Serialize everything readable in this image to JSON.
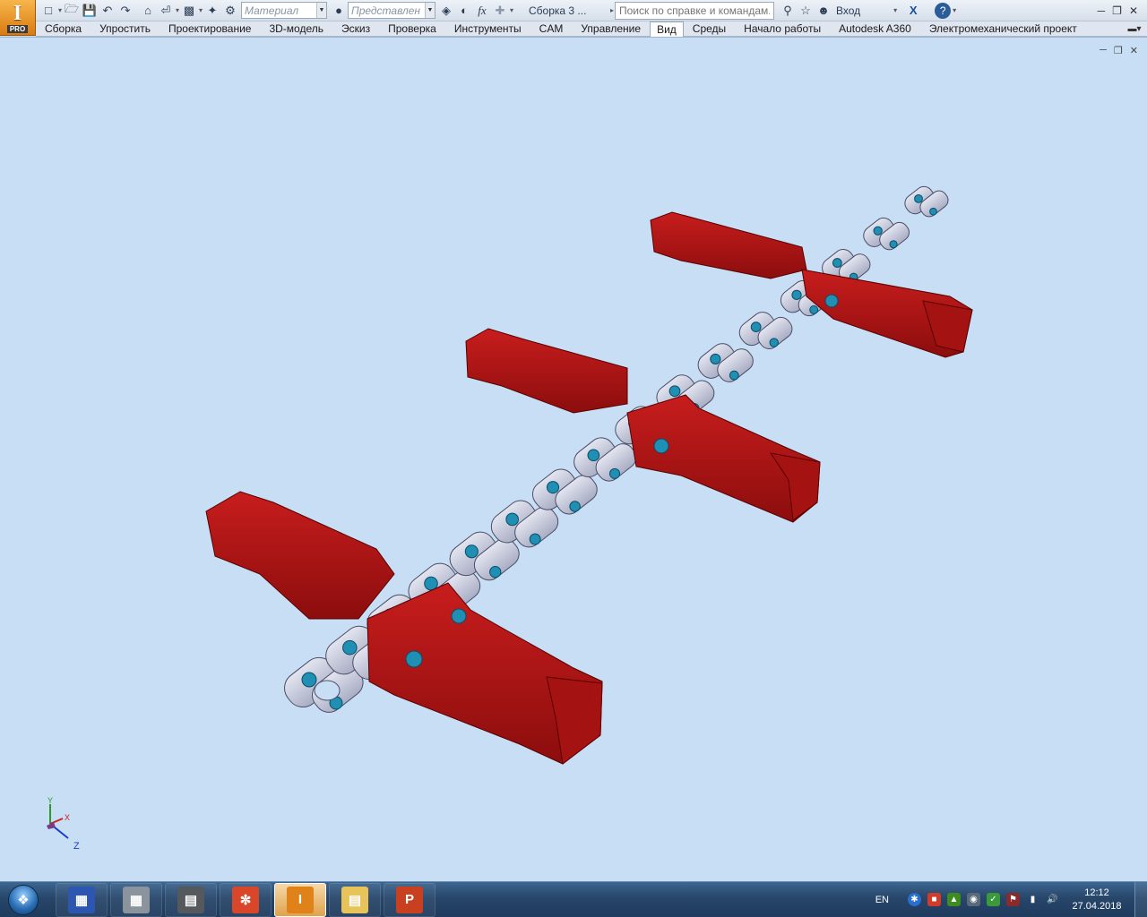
{
  "app": {
    "logo": "I",
    "edition": "PRO",
    "document_title": "Сборка 3 ...",
    "search_placeholder": "Поиск по справке и командам...",
    "sign_in": "Вход",
    "help": "?",
    "material_placeholder": "Материал",
    "appearance_placeholder": "Представлен",
    "formula_label": "fx"
  },
  "ribbon_tabs": [
    "Сборка",
    "Упростить",
    "Проектирование",
    "3D-модель",
    "Эскиз",
    "Проверка",
    "Инструменты",
    "CAM",
    "Управление",
    "Вид",
    "Среды",
    "Начало работы",
    "Autodesk A360",
    "Электромеханический проект"
  ],
  "active_tab": "Вид",
  "viewcube_axes": {
    "x": "X",
    "y": "Y",
    "z": "Z"
  },
  "taskbar": {
    "language": "EN",
    "time": "12:12",
    "date": "27.04.2018",
    "pinned": [
      "save-app-icon",
      "calculator-icon",
      "scanner-icon",
      "paint-icon",
      "inventor-icon",
      "explorer-icon",
      "powerpoint-icon"
    ],
    "active_app": "inventor-icon"
  },
  "colors": {
    "viewport_bg": "#c7def4",
    "chain_link": "#c9ccdd",
    "pin": "#1f8fb4",
    "attachment_red": "#b51616"
  }
}
